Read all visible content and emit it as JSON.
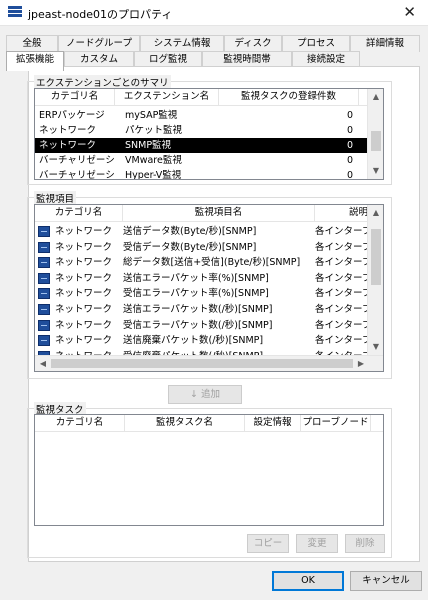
{
  "window": {
    "title": "jpeast-node01のプロパティ",
    "close_glyph": "✕",
    "app_icon": "server-icon"
  },
  "tabs_row1": [
    "全般",
    "ノードグループ",
    "システム情報",
    "ディスク",
    "プロセス",
    "詳細情報"
  ],
  "tabs_row2": [
    "拡張機能",
    "カスタム",
    "ログ監視",
    "監視時間帯",
    "接続設定"
  ],
  "active_tab": "拡張機能",
  "extensions": {
    "title": "エクステンションごとのサマリ",
    "columns": [
      "カテゴリ名",
      "エクステンション名",
      "監視タスクの登録件数"
    ],
    "rows": [
      [
        "ERPパッケージ",
        "mySAP監視",
        "0"
      ],
      [
        "ネットワーク",
        "パケット監視",
        "0"
      ],
      [
        "ネットワーク",
        "SNMP監視",
        "0"
      ],
      [
        "バーチャリゼーション",
        "VMware監視",
        "0"
      ],
      [
        "バーチャリゼーション",
        "Hyper-V監視",
        "0"
      ]
    ],
    "selected_index": 2
  },
  "monitor_items": {
    "title": "監視項目",
    "columns": [
      "カテゴリ名",
      "監視項目名",
      "説明"
    ],
    "rows": [
      [
        "ネットワーク",
        "送信データ数(Byte/秒)[SNMP]",
        "各インターフェ"
      ],
      [
        "ネットワーク",
        "受信データ数(Byte/秒)[SNMP]",
        "各インターフェ"
      ],
      [
        "ネットワーク",
        "総データ数[送信+受信](Byte/秒)[SNMP]",
        "各インターフェ"
      ],
      [
        "ネットワーク",
        "送信エラーパケット率(%)[SNMP]",
        "各インターフェ"
      ],
      [
        "ネットワーク",
        "受信エラーパケット率(%)[SNMP]",
        "各インターフェ"
      ],
      [
        "ネットワーク",
        "送信エラーパケット数(/秒)[SNMP]",
        "各インターフェ"
      ],
      [
        "ネットワーク",
        "受信エラーパケット数(/秒)[SNMP]",
        "各インターフェ"
      ],
      [
        "ネットワーク",
        "送信廃棄パケット数(/秒)[SNMP]",
        "各インターフェ"
      ],
      [
        "ネットワーク",
        "受信廃棄パケット数(/秒)[SNMP]",
        "各インターフェ"
      ]
    ]
  },
  "add_button": "↓ 追加",
  "monitor_tasks": {
    "title": "監視タスク",
    "columns": [
      "カテゴリ名",
      "監視タスク名",
      "設定情報",
      "プローブノード"
    ],
    "buttons": [
      "コピー",
      "変更",
      "削除"
    ]
  },
  "footer": {
    "ok": "OK",
    "cancel": "キャンセル"
  }
}
